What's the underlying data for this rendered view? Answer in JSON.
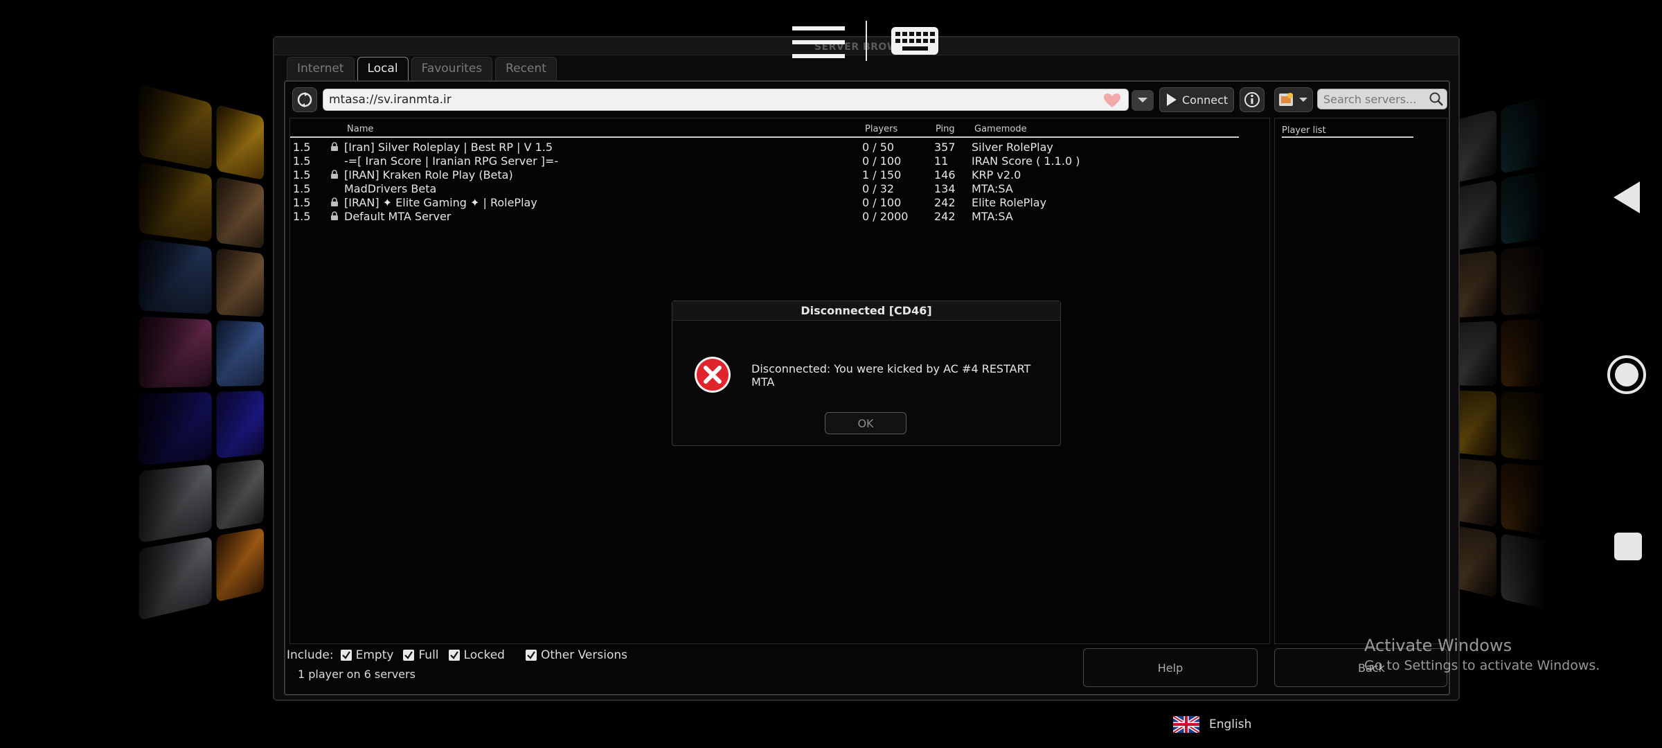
{
  "window": {
    "title": "SERVER BROWSER"
  },
  "tabs": [
    {
      "label": "Internet",
      "active": false
    },
    {
      "label": "Local",
      "active": true
    },
    {
      "label": "Favourites",
      "active": false
    },
    {
      "label": "Recent",
      "active": false
    }
  ],
  "toolbar": {
    "address": "mtasa://sv.iranmta.ir",
    "connect_label": "Connect",
    "search_placeholder": "Search servers..."
  },
  "server_list": {
    "columns": {
      "name": "Name",
      "players": "Players",
      "ping": "Ping",
      "gamemode": "Gamemode"
    },
    "rows": [
      {
        "version": "1.5",
        "locked": true,
        "name": "[Iran] Silver Roleplay | Best RP | V 1.5",
        "players": "0 / 50",
        "ping": "357",
        "gamemode": "Silver RolePlay"
      },
      {
        "version": "1.5",
        "locked": false,
        "name": "-=[ Iran Score | Iranian RPG Server ]=-",
        "players": "0 / 100",
        "ping": "11",
        "gamemode": "IRAN Score ( 1.1.0 )"
      },
      {
        "version": "1.5",
        "locked": true,
        "name": "[IRAN] Kraken Role Play (Beta)",
        "players": "1 / 150",
        "ping": "146",
        "gamemode": "KRP v2.0"
      },
      {
        "version": "1.5",
        "locked": false,
        "name": "MadDrivers Beta",
        "players": "0 / 32",
        "ping": "134",
        "gamemode": "MTA:SA"
      },
      {
        "version": "1.5",
        "locked": true,
        "name": "[IRAN] ✦ Elite Gaming ✦ | RolePlay",
        "players": "0 / 100",
        "ping": "242",
        "gamemode": "Elite RolePlay"
      },
      {
        "version": "1.5",
        "locked": true,
        "name": "Default MTA Server",
        "players": "0 / 2000",
        "ping": "242",
        "gamemode": "MTA:SA"
      }
    ]
  },
  "player_list": {
    "header": "Player list"
  },
  "filters": {
    "include_label": "Include:",
    "empty": "Empty",
    "full": "Full",
    "locked": "Locked",
    "other_versions": "Other Versions"
  },
  "status": "1 player on 6 servers",
  "buttons": {
    "help": "Help",
    "back": "Back"
  },
  "watermark": {
    "title": "Activate Windows",
    "subtitle": "Go to Settings to activate Windows."
  },
  "language": "English",
  "dialog": {
    "title": "Disconnected [CD46]",
    "message": "Disconnected: You were kicked by AC #4 RESTART MTA",
    "ok_label": "OK"
  },
  "colors": {
    "background": "#000000",
    "window": "#0c0a0c",
    "error_red": "#e0242c",
    "address_bar": "#f2f2f2"
  },
  "icons": [
    "refresh-icon",
    "heart-icon",
    "chevron-down-icon",
    "play-icon",
    "info-icon",
    "search-icon",
    "lock-icon",
    "check-icon",
    "error-icon",
    "menu-icon",
    "keyboard-icon",
    "uk-flag-icon",
    "nav-back-icon",
    "nav-home-icon",
    "nav-recents-icon"
  ]
}
